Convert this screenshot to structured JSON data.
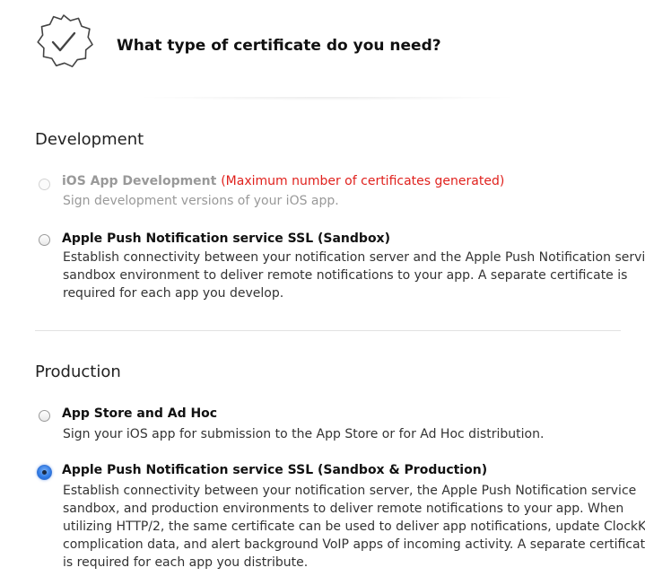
{
  "header": {
    "title": "What type of certificate do you need?",
    "icon": "certificate-seal-icon"
  },
  "sections": [
    {
      "title": "Development",
      "options": [
        {
          "title": "iOS App Development",
          "note": "(Maximum number of certificates generated)",
          "description_lines": [
            "Sign development versions of your iOS app."
          ],
          "state": "disabled"
        },
        {
          "title": "Apple Push Notification service SSL (Sandbox)",
          "note": "",
          "description_lines": [
            "Establish connectivity between your notification server and the Apple Push Notification service",
            "sandbox environment to deliver remote notifications to your app. A separate certificate is",
            "required for each app you develop."
          ],
          "state": "unchecked"
        }
      ]
    },
    {
      "title": "Production",
      "options": [
        {
          "title": "App Store and Ad Hoc",
          "note": "",
          "description_lines": [
            "Sign your iOS app for submission to the App Store or for Ad Hoc distribution."
          ],
          "state": "unchecked"
        },
        {
          "title": "Apple Push Notification service SSL (Sandbox & Production)",
          "note": "",
          "description_lines": [
            "Establish connectivity between your notification server, the Apple Push Notification service",
            "sandbox, and production environments to deliver remote notifications to your app. When",
            "utilizing HTTP/2, the same certificate can be used to deliver app notifications, update ClockKit",
            "complication data, and alert background VoIP apps of incoming activity. A separate certificate",
            "is required for each app you distribute."
          ],
          "state": "checked"
        }
      ]
    }
  ],
  "colors": {
    "accent": "#2f7ae5",
    "warning": "#e0211d",
    "disabled_text": "#999999"
  }
}
